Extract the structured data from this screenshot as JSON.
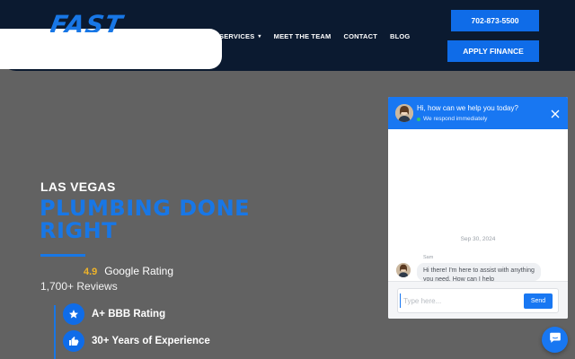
{
  "header": {
    "logo_text": "FAST",
    "nav": [
      {
        "label": "SERVICES",
        "has_dropdown": true
      },
      {
        "label": "MEET THE TEAM",
        "has_dropdown": false
      },
      {
        "label": "CONTACT",
        "has_dropdown": false
      },
      {
        "label": "BLOG",
        "has_dropdown": false
      }
    ],
    "phone_button": "702-873-5500",
    "finance_button": "APPLY FINANCE"
  },
  "hero": {
    "subtitle": "LAS VEGAS",
    "title": "PLUMBING DONE RIGHT",
    "rating_score": "4.9",
    "rating_label": "Google Rating",
    "reviews": "1,700+ Reviews",
    "features": [
      {
        "icon": "star-icon",
        "label": "A+ BBB Rating"
      },
      {
        "icon": "thumbs-up-icon",
        "label": "30+ Years of Experience"
      }
    ]
  },
  "chat": {
    "greeting": "Hi, how can we help you today?",
    "respond_status": "We respond immediately",
    "date": "Sep 30, 2024",
    "sender": "Sam",
    "message": "Hi there!   I'm here to assist with anything you need. How can I help",
    "input_placeholder": "Type here...",
    "send_label": "Send"
  },
  "colors": {
    "header_bg": "#0b1a30",
    "accent": "#1877e6",
    "page_bg": "#626262",
    "rating_star": "#f0b429"
  }
}
